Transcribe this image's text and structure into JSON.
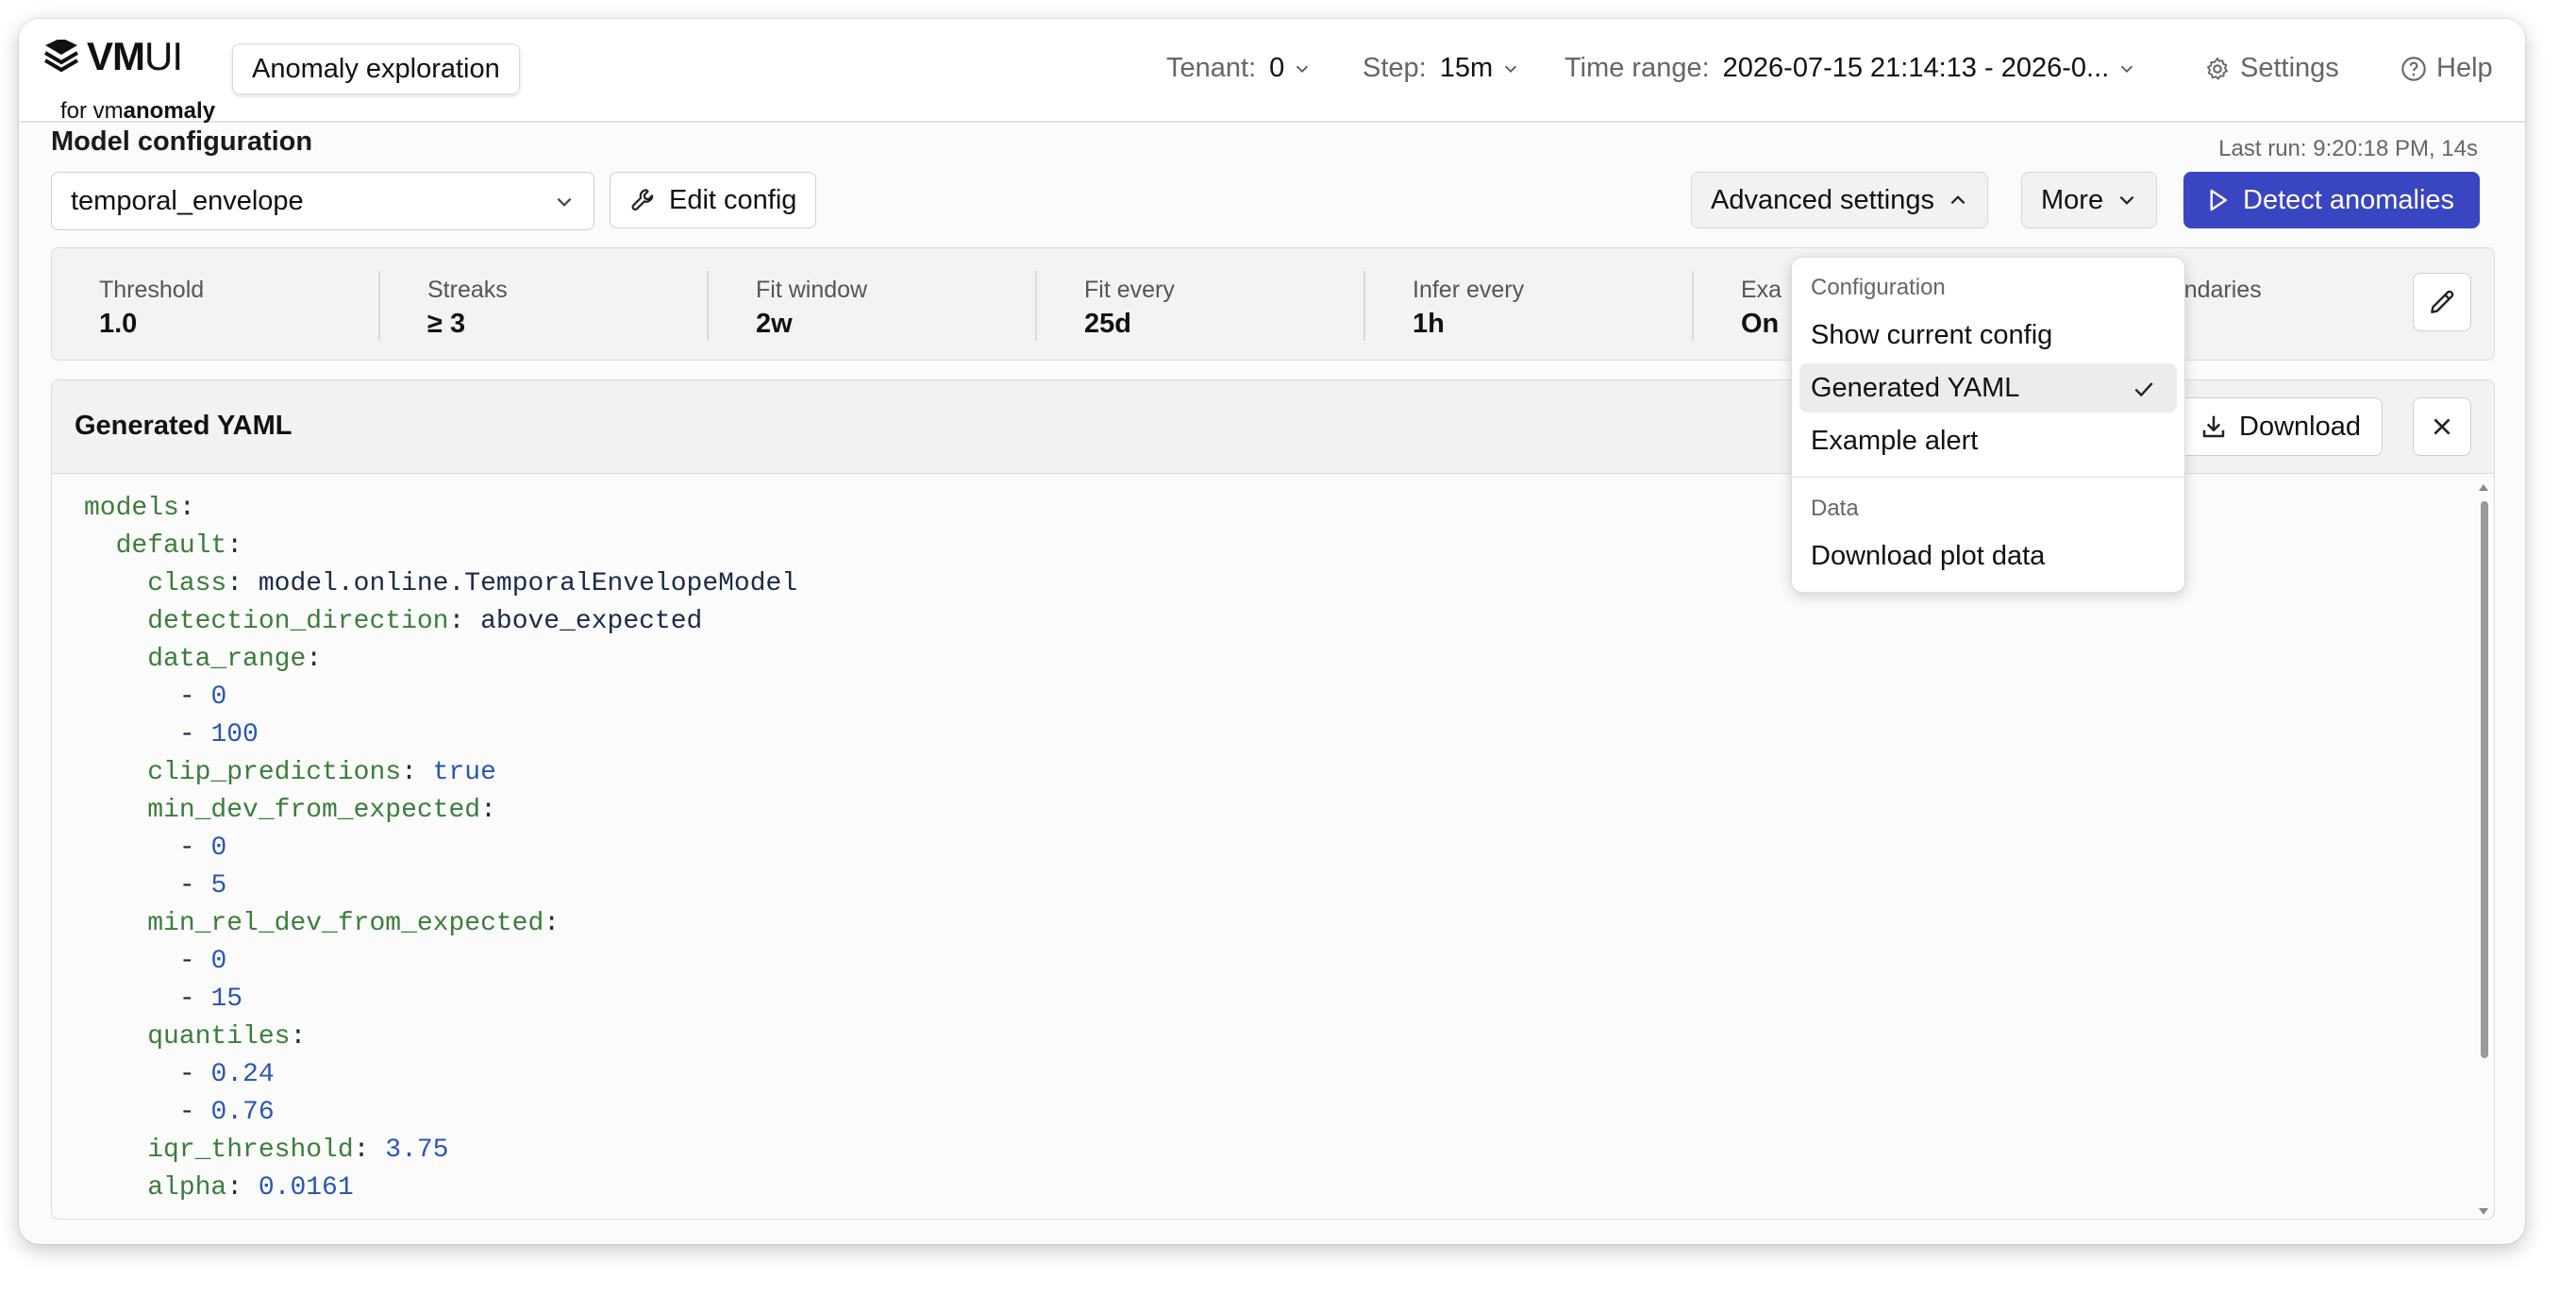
{
  "header": {
    "logo_main": "VM",
    "logo_light": "UI",
    "logo_sub_prefix": "for vm",
    "logo_sub_bold": "anomaly",
    "app_chip": "Anomaly exploration",
    "tenant_label": "Tenant:",
    "tenant_value": "0",
    "step_label": "Step:",
    "step_value": "15m",
    "time_range_label": "Time range:",
    "time_range_value": "2026-07-15 21:14:13 - 2026-0...",
    "settings_label": "Settings",
    "help_label": "Help"
  },
  "config": {
    "title": "Model configuration",
    "last_run": "Last run: 9:20:18 PM, 14s",
    "model_value": "temporal_envelope",
    "edit_config_label": "Edit config",
    "advanced_settings_label": "Advanced settings",
    "more_label": "More",
    "detect_label": "Detect anomalies"
  },
  "stats": [
    {
      "label": "Threshold",
      "value": "1.0"
    },
    {
      "label": "Streaks",
      "value": "≥ 3"
    },
    {
      "label": "Fit window",
      "value": "2w"
    },
    {
      "label": "Fit every",
      "value": "25d"
    },
    {
      "label": "Infer every",
      "value": "1h"
    },
    {
      "label": "Exa",
      "value": "On"
    },
    {
      "label": "boundaries",
      "value": ""
    }
  ],
  "yaml": {
    "title": "Generated YAML",
    "download_label": "Download",
    "lines": [
      {
        "indent": "",
        "key": "models",
        "sep": ":",
        "val": "",
        "type": ""
      },
      {
        "indent": "  ",
        "key": "default",
        "sep": ":",
        "val": "",
        "type": ""
      },
      {
        "indent": "    ",
        "key": "class",
        "sep": ": ",
        "val": "model.online.TemporalEnvelopeModel",
        "type": "s"
      },
      {
        "indent": "    ",
        "key": "detection_direction",
        "sep": ": ",
        "val": "above_expected",
        "type": "s"
      },
      {
        "indent": "    ",
        "key": "data_range",
        "sep": ":",
        "val": "",
        "type": ""
      },
      {
        "indent": "      ",
        "key": "",
        "sep": "- ",
        "val": "0",
        "type": "n"
      },
      {
        "indent": "      ",
        "key": "",
        "sep": "- ",
        "val": "100",
        "type": "n"
      },
      {
        "indent": "    ",
        "key": "clip_predictions",
        "sep": ": ",
        "val": "true",
        "type": "n"
      },
      {
        "indent": "    ",
        "key": "min_dev_from_expected",
        "sep": ":",
        "val": "",
        "type": ""
      },
      {
        "indent": "      ",
        "key": "",
        "sep": "- ",
        "val": "0",
        "type": "n"
      },
      {
        "indent": "      ",
        "key": "",
        "sep": "- ",
        "val": "5",
        "type": "n"
      },
      {
        "indent": "    ",
        "key": "min_rel_dev_from_expected",
        "sep": ":",
        "val": "",
        "type": ""
      },
      {
        "indent": "      ",
        "key": "",
        "sep": "- ",
        "val": "0",
        "type": "n"
      },
      {
        "indent": "      ",
        "key": "",
        "sep": "- ",
        "val": "15",
        "type": "n"
      },
      {
        "indent": "    ",
        "key": "quantiles",
        "sep": ":",
        "val": "",
        "type": ""
      },
      {
        "indent": "      ",
        "key": "",
        "sep": "- ",
        "val": "0.24",
        "type": "n"
      },
      {
        "indent": "      ",
        "key": "",
        "sep": "- ",
        "val": "0.76",
        "type": "n"
      },
      {
        "indent": "    ",
        "key": "iqr_threshold",
        "sep": ": ",
        "val": "3.75",
        "type": "n"
      },
      {
        "indent": "    ",
        "key": "alpha",
        "sep": ": ",
        "val": "0.0161",
        "type": "n"
      }
    ]
  },
  "dropdown": {
    "group1": "Configuration",
    "items1": [
      "Show current config",
      "Generated YAML",
      "Example alert"
    ],
    "selected": "Generated YAML",
    "group2": "Data",
    "items2": [
      "Download plot data"
    ]
  }
}
